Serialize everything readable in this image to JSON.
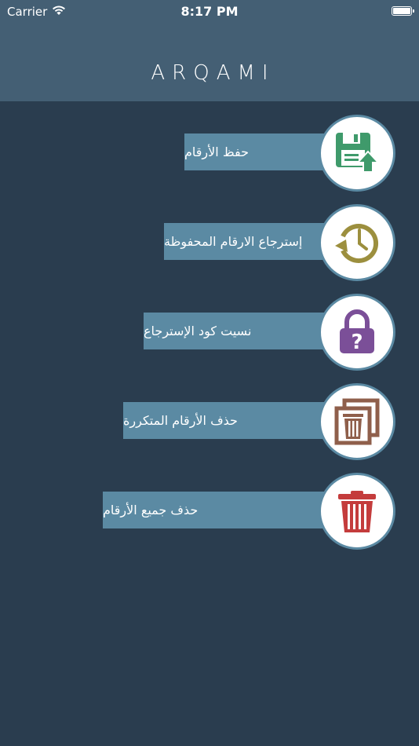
{
  "status_bar": {
    "carrier": "Carrier",
    "time": "8:17 PM"
  },
  "header": {
    "title": "ARQAMI"
  },
  "menu": [
    {
      "label": "حفظ الأرقام",
      "icon": "save-floppy-icon",
      "color": "#3f9a6b"
    },
    {
      "label": "إسترجاع الارقام المحفوظة",
      "icon": "restore-clock-icon",
      "color": "#9c8f3e"
    },
    {
      "label": "نسيت كود الإسترجاع",
      "icon": "padlock-question-icon",
      "color": "#7b4f98"
    },
    {
      "label": "حذف الأرقام المتكررة",
      "icon": "duplicate-trash-icon",
      "color": "#8f5f4b"
    },
    {
      "label": "حذف جميع الأرقام",
      "icon": "trash-icon",
      "color": "#c43c3c"
    }
  ],
  "colors": {
    "background": "#2a3d4f",
    "header": "#445f74",
    "label_bar": "#5b8aa3"
  }
}
